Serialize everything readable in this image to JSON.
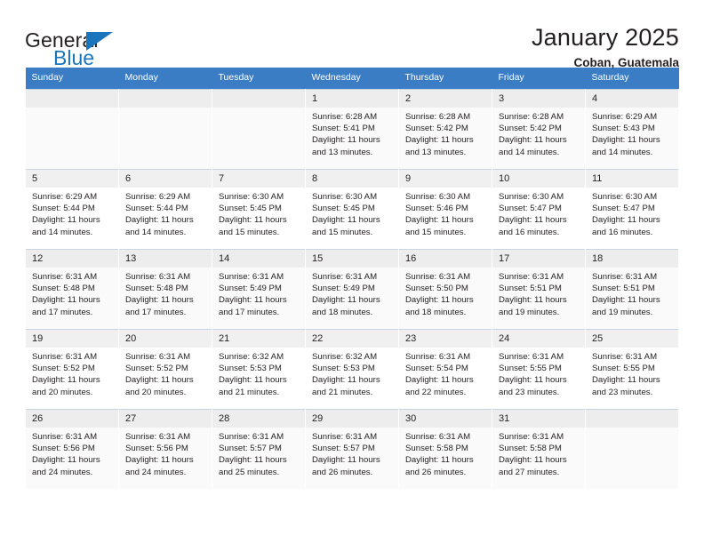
{
  "brand": {
    "name_part1": "General",
    "name_part2": "Blue",
    "accent_color": "#1b75bc"
  },
  "header": {
    "title": "January 2025",
    "subtitle": "Coban, Guatemala",
    "header_bg": "#3b7dc4"
  },
  "weekdays": [
    "Sunday",
    "Monday",
    "Tuesday",
    "Wednesday",
    "Thursday",
    "Friday",
    "Saturday"
  ],
  "labels": {
    "sunrise": "Sunrise:",
    "sunset": "Sunset:",
    "daylight": "Daylight:"
  },
  "weeks": [
    [
      {
        "empty": true
      },
      {
        "empty": true
      },
      {
        "empty": true
      },
      {
        "day": "1",
        "sunrise": "Sunrise: 6:28 AM",
        "sunset": "Sunset: 5:41 PM",
        "daylight_l1": "Daylight: 11 hours",
        "daylight_l2": "and 13 minutes."
      },
      {
        "day": "2",
        "sunrise": "Sunrise: 6:28 AM",
        "sunset": "Sunset: 5:42 PM",
        "daylight_l1": "Daylight: 11 hours",
        "daylight_l2": "and 13 minutes."
      },
      {
        "day": "3",
        "sunrise": "Sunrise: 6:28 AM",
        "sunset": "Sunset: 5:42 PM",
        "daylight_l1": "Daylight: 11 hours",
        "daylight_l2": "and 14 minutes."
      },
      {
        "day": "4",
        "sunrise": "Sunrise: 6:29 AM",
        "sunset": "Sunset: 5:43 PM",
        "daylight_l1": "Daylight: 11 hours",
        "daylight_l2": "and 14 minutes."
      }
    ],
    [
      {
        "day": "5",
        "sunrise": "Sunrise: 6:29 AM",
        "sunset": "Sunset: 5:44 PM",
        "daylight_l1": "Daylight: 11 hours",
        "daylight_l2": "and 14 minutes."
      },
      {
        "day": "6",
        "sunrise": "Sunrise: 6:29 AM",
        "sunset": "Sunset: 5:44 PM",
        "daylight_l1": "Daylight: 11 hours",
        "daylight_l2": "and 14 minutes."
      },
      {
        "day": "7",
        "sunrise": "Sunrise: 6:30 AM",
        "sunset": "Sunset: 5:45 PM",
        "daylight_l1": "Daylight: 11 hours",
        "daylight_l2": "and 15 minutes."
      },
      {
        "day": "8",
        "sunrise": "Sunrise: 6:30 AM",
        "sunset": "Sunset: 5:45 PM",
        "daylight_l1": "Daylight: 11 hours",
        "daylight_l2": "and 15 minutes."
      },
      {
        "day": "9",
        "sunrise": "Sunrise: 6:30 AM",
        "sunset": "Sunset: 5:46 PM",
        "daylight_l1": "Daylight: 11 hours",
        "daylight_l2": "and 15 minutes."
      },
      {
        "day": "10",
        "sunrise": "Sunrise: 6:30 AM",
        "sunset": "Sunset: 5:47 PM",
        "daylight_l1": "Daylight: 11 hours",
        "daylight_l2": "and 16 minutes."
      },
      {
        "day": "11",
        "sunrise": "Sunrise: 6:30 AM",
        "sunset": "Sunset: 5:47 PM",
        "daylight_l1": "Daylight: 11 hours",
        "daylight_l2": "and 16 minutes."
      }
    ],
    [
      {
        "day": "12",
        "sunrise": "Sunrise: 6:31 AM",
        "sunset": "Sunset: 5:48 PM",
        "daylight_l1": "Daylight: 11 hours",
        "daylight_l2": "and 17 minutes."
      },
      {
        "day": "13",
        "sunrise": "Sunrise: 6:31 AM",
        "sunset": "Sunset: 5:48 PM",
        "daylight_l1": "Daylight: 11 hours",
        "daylight_l2": "and 17 minutes."
      },
      {
        "day": "14",
        "sunrise": "Sunrise: 6:31 AM",
        "sunset": "Sunset: 5:49 PM",
        "daylight_l1": "Daylight: 11 hours",
        "daylight_l2": "and 17 minutes."
      },
      {
        "day": "15",
        "sunrise": "Sunrise: 6:31 AM",
        "sunset": "Sunset: 5:49 PM",
        "daylight_l1": "Daylight: 11 hours",
        "daylight_l2": "and 18 minutes."
      },
      {
        "day": "16",
        "sunrise": "Sunrise: 6:31 AM",
        "sunset": "Sunset: 5:50 PM",
        "daylight_l1": "Daylight: 11 hours",
        "daylight_l2": "and 18 minutes."
      },
      {
        "day": "17",
        "sunrise": "Sunrise: 6:31 AM",
        "sunset": "Sunset: 5:51 PM",
        "daylight_l1": "Daylight: 11 hours",
        "daylight_l2": "and 19 minutes."
      },
      {
        "day": "18",
        "sunrise": "Sunrise: 6:31 AM",
        "sunset": "Sunset: 5:51 PM",
        "daylight_l1": "Daylight: 11 hours",
        "daylight_l2": "and 19 minutes."
      }
    ],
    [
      {
        "day": "19",
        "sunrise": "Sunrise: 6:31 AM",
        "sunset": "Sunset: 5:52 PM",
        "daylight_l1": "Daylight: 11 hours",
        "daylight_l2": "and 20 minutes."
      },
      {
        "day": "20",
        "sunrise": "Sunrise: 6:31 AM",
        "sunset": "Sunset: 5:52 PM",
        "daylight_l1": "Daylight: 11 hours",
        "daylight_l2": "and 20 minutes."
      },
      {
        "day": "21",
        "sunrise": "Sunrise: 6:32 AM",
        "sunset": "Sunset: 5:53 PM",
        "daylight_l1": "Daylight: 11 hours",
        "daylight_l2": "and 21 minutes."
      },
      {
        "day": "22",
        "sunrise": "Sunrise: 6:32 AM",
        "sunset": "Sunset: 5:53 PM",
        "daylight_l1": "Daylight: 11 hours",
        "daylight_l2": "and 21 minutes."
      },
      {
        "day": "23",
        "sunrise": "Sunrise: 6:31 AM",
        "sunset": "Sunset: 5:54 PM",
        "daylight_l1": "Daylight: 11 hours",
        "daylight_l2": "and 22 minutes."
      },
      {
        "day": "24",
        "sunrise": "Sunrise: 6:31 AM",
        "sunset": "Sunset: 5:55 PM",
        "daylight_l1": "Daylight: 11 hours",
        "daylight_l2": "and 23 minutes."
      },
      {
        "day": "25",
        "sunrise": "Sunrise: 6:31 AM",
        "sunset": "Sunset: 5:55 PM",
        "daylight_l1": "Daylight: 11 hours",
        "daylight_l2": "and 23 minutes."
      }
    ],
    [
      {
        "day": "26",
        "sunrise": "Sunrise: 6:31 AM",
        "sunset": "Sunset: 5:56 PM",
        "daylight_l1": "Daylight: 11 hours",
        "daylight_l2": "and 24 minutes."
      },
      {
        "day": "27",
        "sunrise": "Sunrise: 6:31 AM",
        "sunset": "Sunset: 5:56 PM",
        "daylight_l1": "Daylight: 11 hours",
        "daylight_l2": "and 24 minutes."
      },
      {
        "day": "28",
        "sunrise": "Sunrise: 6:31 AM",
        "sunset": "Sunset: 5:57 PM",
        "daylight_l1": "Daylight: 11 hours",
        "daylight_l2": "and 25 minutes."
      },
      {
        "day": "29",
        "sunrise": "Sunrise: 6:31 AM",
        "sunset": "Sunset: 5:57 PM",
        "daylight_l1": "Daylight: 11 hours",
        "daylight_l2": "and 26 minutes."
      },
      {
        "day": "30",
        "sunrise": "Sunrise: 6:31 AM",
        "sunset": "Sunset: 5:58 PM",
        "daylight_l1": "Daylight: 11 hours",
        "daylight_l2": "and 26 minutes."
      },
      {
        "day": "31",
        "sunrise": "Sunrise: 6:31 AM",
        "sunset": "Sunset: 5:58 PM",
        "daylight_l1": "Daylight: 11 hours",
        "daylight_l2": "and 27 minutes."
      },
      {
        "empty": true
      }
    ]
  ]
}
